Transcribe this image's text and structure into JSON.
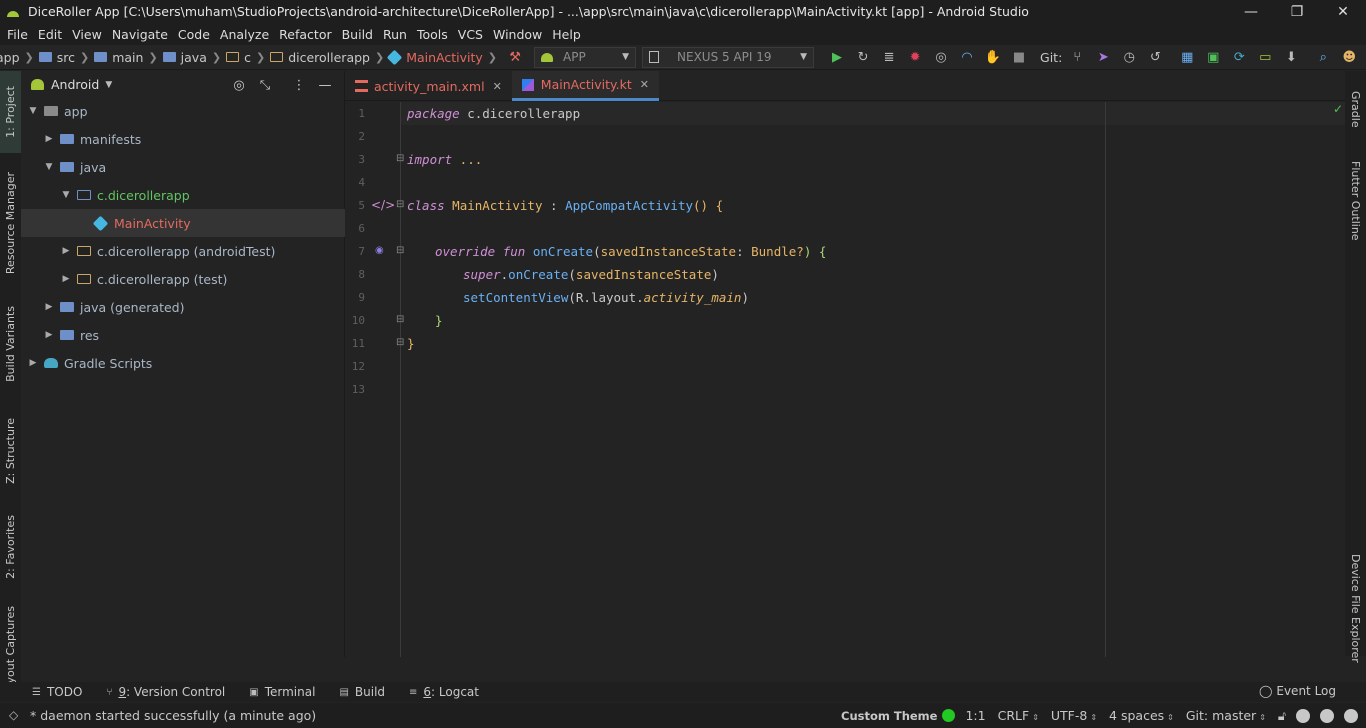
{
  "window": {
    "title": "DiceRoller App [C:\\Users\\muham\\StudioProjects\\android-architecture\\DiceRollerApp] - ...\\app\\src\\main\\java\\c\\dicerollerapp\\MainActivity.kt [app] - Android Studio",
    "minimize": "—",
    "restore": "❐",
    "close": "✕"
  },
  "menu": [
    "File",
    "Edit",
    "View",
    "Navigate",
    "Code",
    "Analyze",
    "Refactor",
    "Build",
    "Run",
    "Tools",
    "VCS",
    "Window",
    "Help"
  ],
  "breadcrumb": {
    "app": "app",
    "src": "src",
    "main": "main",
    "java": "java",
    "c": "c",
    "pkg": "dicerollerapp",
    "file": "MainActivity"
  },
  "toolbar": {
    "run_config": "APP",
    "device": "NEXUS 5 API 19",
    "git_label": "Git:"
  },
  "left_tabs": [
    "1: Project",
    "Resource Manager",
    "Build Variants",
    "Z: Structure",
    "2: Favorites",
    "yout Captures"
  ],
  "right_tabs": [
    "Gradle",
    "Flutter Outline",
    "Device File Explorer"
  ],
  "project": {
    "view": "Android",
    "tree": [
      {
        "label": "app",
        "color": "#a9b7c6"
      },
      {
        "label": "manifests",
        "color": "#a9b7c6"
      },
      {
        "label": "java",
        "color": "#a9b7c6"
      },
      {
        "label": "c.dicerollerapp",
        "color": "#62c462"
      },
      {
        "label": "MainActivity",
        "color": "#e46a5f"
      },
      {
        "label": "c.dicerollerapp (androidTest)",
        "color": "#a9b7c6"
      },
      {
        "label": "c.dicerollerapp (test)",
        "color": "#a9b7c6"
      },
      {
        "label": "java (generated)",
        "color": "#a9b7c6"
      },
      {
        "label": "res",
        "color": "#a9b7c6"
      },
      {
        "label": "Gradle Scripts",
        "color": "#a9b7c6"
      }
    ]
  },
  "tabs": [
    {
      "label": "activity_main.xml",
      "color": "#e46a5f"
    },
    {
      "label": "MainActivity.kt",
      "color": "#e46a5f"
    }
  ],
  "code": {
    "line_numbers": [
      "1",
      "2",
      "3",
      "4",
      "5",
      "6",
      "7",
      "8",
      "9",
      "10",
      "11",
      "12",
      "13"
    ],
    "l1_kw": "package",
    "l1_rest": " c.dicerollerapp",
    "l3_kw": "import",
    "l3_rest": " ...",
    "l6_kw": "class",
    "l6_name": " MainActivity",
    "l6_colon": " : ",
    "l6_super": "AppCompatActivity",
    "l6_end": "() {",
    "l8_kw1": "override",
    "l8_kw2": " fun",
    "l8_fn": " onCreate",
    "l8_open": "(",
    "l8_param": "savedInstanceState",
    "l8_colon": ": ",
    "l8_type": "Bundle?",
    "l8_end": ") {",
    "l9_kw": "super",
    "l9_dot": ".",
    "l9_fn": "onCreate",
    "l9_open": "(",
    "l9_arg": "savedInstanceState",
    "l9_close": ")",
    "l10_fn": "setContentView",
    "l10_open": "(",
    "l10_r": "R.layout.",
    "l10_res": "activity_main",
    "l10_close": ")",
    "l11": "}",
    "l12": "}"
  },
  "bottom_tools": {
    "todo": "TODO",
    "vc_num": "9",
    "vc": ": Version Control",
    "terminal": "Terminal",
    "build": "Build",
    "logcat_num": "6",
    "logcat": ": Logcat",
    "event_log": "Event Log"
  },
  "status": {
    "message": "* daemon started successfully (a minute ago)",
    "theme": "Custom Theme",
    "position": "1:1",
    "line_sep": "CRLF",
    "encoding": "UTF-8",
    "indent": "4 spaces",
    "git": "Git: master"
  }
}
